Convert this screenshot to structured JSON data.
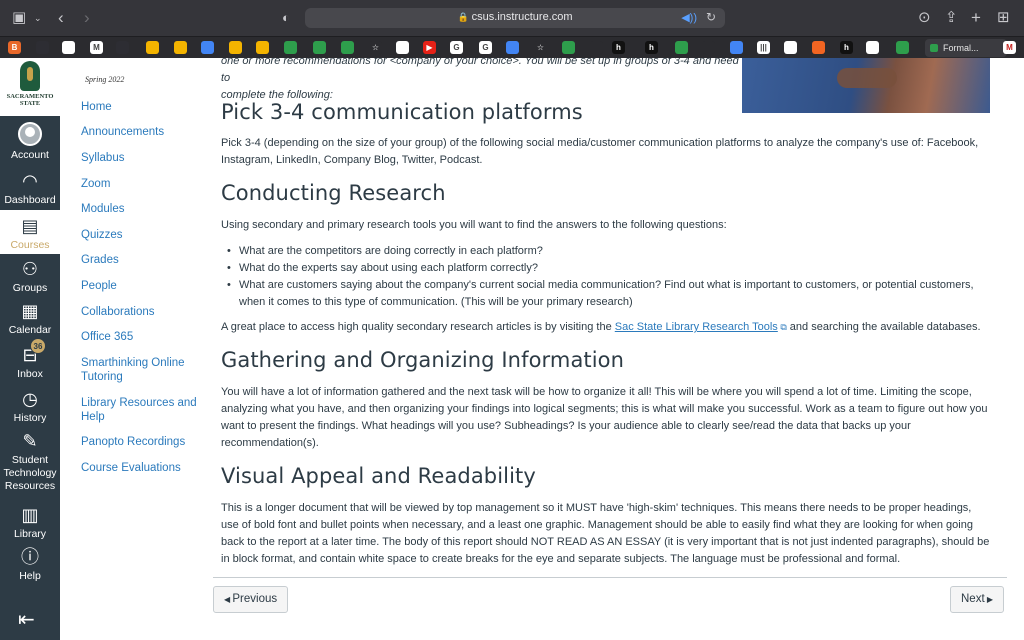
{
  "browser": {
    "url": "csus.instructure.com",
    "tab_title": "Formal..."
  },
  "bookmarks": [
    {
      "icon": "bookmark-orange-icon",
      "glyph": "B",
      "color": "#e8682a"
    },
    {
      "icon": "bookmark-mountain-icon",
      "glyph": "",
      "color": "#2d2d33"
    },
    {
      "icon": "bookmark-square-icon",
      "glyph": "",
      "color": "#ffffff"
    },
    {
      "icon": "gmail-icon",
      "glyph": "M",
      "color": "#ffffff"
    },
    {
      "icon": "apple-icon",
      "glyph": "",
      "color": "#2d2d33"
    },
    {
      "icon": "bookmark-yellow-icon",
      "glyph": "",
      "color": "#f4b400"
    },
    {
      "icon": "bookmark-yellow-icon",
      "glyph": "",
      "color": "#f4b400"
    },
    {
      "icon": "docs-icon",
      "glyph": "",
      "color": "#4285f4"
    },
    {
      "icon": "bookmark-yellow-icon",
      "glyph": "",
      "color": "#f4b400"
    },
    {
      "icon": "bookmark-yellow-icon",
      "glyph": "",
      "color": "#f4b400"
    },
    {
      "icon": "bookmark-green-icon",
      "glyph": "",
      "color": "#2e9e4c"
    },
    {
      "icon": "bookmark-green-icon",
      "glyph": "",
      "color": "#2e9e4c"
    },
    {
      "icon": "bookmark-green-icon",
      "glyph": "",
      "color": "#2e9e4c"
    },
    {
      "icon": "star-icon",
      "glyph": "☆",
      "color": "#2b2b2f"
    },
    {
      "icon": "bookmark-square-icon",
      "glyph": "",
      "color": "#ffffff"
    },
    {
      "icon": "youtube-icon",
      "glyph": "▶",
      "color": "#e62117"
    },
    {
      "icon": "google-icon",
      "glyph": "G",
      "color": "#ffffff"
    },
    {
      "icon": "google-icon",
      "glyph": "G",
      "color": "#ffffff"
    },
    {
      "icon": "docs-icon",
      "glyph": "",
      "color": "#4285f4"
    },
    {
      "icon": "star-icon",
      "glyph": "☆",
      "color": "#2b2b2f"
    },
    {
      "icon": "bookmark-green-icon",
      "glyph": "",
      "color": "#2e9e4c"
    },
    {
      "icon": "bookmark-dark-icon",
      "glyph": "",
      "color": "#2b2b2f"
    },
    {
      "icon": "bookmark-h-icon",
      "glyph": "h",
      "color": "#111111"
    },
    {
      "icon": "bookmark-h-icon",
      "glyph": "h",
      "color": "#111111"
    },
    {
      "icon": "bookmark-green-icon",
      "glyph": "",
      "color": "#2e9e4c"
    },
    {
      "icon": "bookmark-dark-icon",
      "glyph": "",
      "color": "#2b2b2f"
    },
    {
      "icon": "docs-icon",
      "glyph": "",
      "color": "#4285f4"
    },
    {
      "icon": "barcode-icon",
      "glyph": "|||",
      "color": "#ffffff"
    },
    {
      "icon": "bookmark-image-icon",
      "glyph": "",
      "color": "#ffffff"
    },
    {
      "icon": "bookmark-swirl-icon",
      "glyph": "",
      "color": "#f26522"
    },
    {
      "icon": "bookmark-h-icon",
      "glyph": "h",
      "color": "#111111"
    },
    {
      "icon": "bookmark-square-icon",
      "glyph": "",
      "color": "#ffffff"
    },
    {
      "icon": "bookmark-green-icon",
      "glyph": "",
      "color": "#2e9e4c"
    }
  ],
  "institution": {
    "name_line1": "SACRAMENTO",
    "name_line2": "STATE"
  },
  "global_nav": {
    "account": "Account",
    "dashboard": "Dashboard",
    "courses": "Courses",
    "groups": "Groups",
    "calendar": "Calendar",
    "inbox": "Inbox",
    "inbox_badge": "36",
    "history": "History",
    "student_tech_line1": "Student",
    "student_tech_line2": "Technology",
    "student_tech_line3": "Resources",
    "library": "Library",
    "help": "Help"
  },
  "course_nav": {
    "term": "Spring 2022",
    "items": [
      "Home",
      "Announcements",
      "Syllabus",
      "Zoom",
      "Modules",
      "Quizzes",
      "Grades",
      "People",
      "Collaborations",
      "Office 365",
      "Smarthinking Online Tutoring",
      "Library Resources and Help",
      "Panopto Recordings",
      "Course Evaluations"
    ]
  },
  "content": {
    "cut_text_line1": "one or more recommendations for <company of your choice>. You will be set up in groups of 3-4 and need to",
    "cut_text_line2": "complete the following:",
    "h_platforms": "Pick 3-4 communication platforms",
    "p_platforms": "Pick 3-4 (depending on the size of your group) of the following social media/customer communication platforms to analyze the company's use of: Facebook, Instagram, LinkedIn, Company Blog, Twitter, Podcast.",
    "h_research": "Conducting Research",
    "p_research": "Using secondary and primary research tools you will want to find the answers to the following questions:",
    "questions": [
      "What are the competitors are doing correctly in each platform?",
      "What do the experts say about using each platform correctly?",
      "What are customers saying about the company's current social media communication? Find out what is important to customers, or potential customers, when it comes to this type of communication. (This will be your primary research)"
    ],
    "p_library_before": "A great place to access high quality secondary research articles is by visiting the ",
    "library_link": "Sac State Library Research Tools",
    "p_library_after": " and searching the available databases.",
    "h_gathering": "Gathering and Organizing Information",
    "p_gathering": "You will have a lot of information gathered and the next task will be how to organize it all! This will be where you will spend a lot of time. Limiting the scope, analyzing what you have, and then organizing your findings into logical segments; this is what will make you successful. Work as a team to figure out how you want to present the findings. What headings will you use? Subheadings? Is your audience able to clearly see/read the data that backs up your recommendation(s).",
    "h_visual": "Visual Appeal and Readability",
    "p_visual": "This is a longer document that will be viewed by top management so it MUST have 'high-skim' techniques. This means there needs to be proper headings, use of bold font and bullet points when necessary, and a least one graphic. Management should be able to easily find what they are looking for when going back to the report at a later time. The body of this report should NOT READ AS AN ESSAY (it is very important that is not just indented paragraphs), should be in block format, and contain white space to create breaks for the eye and separate subjects. The language must be professional and formal."
  },
  "pager": {
    "previous": "Previous",
    "next": "Next"
  }
}
